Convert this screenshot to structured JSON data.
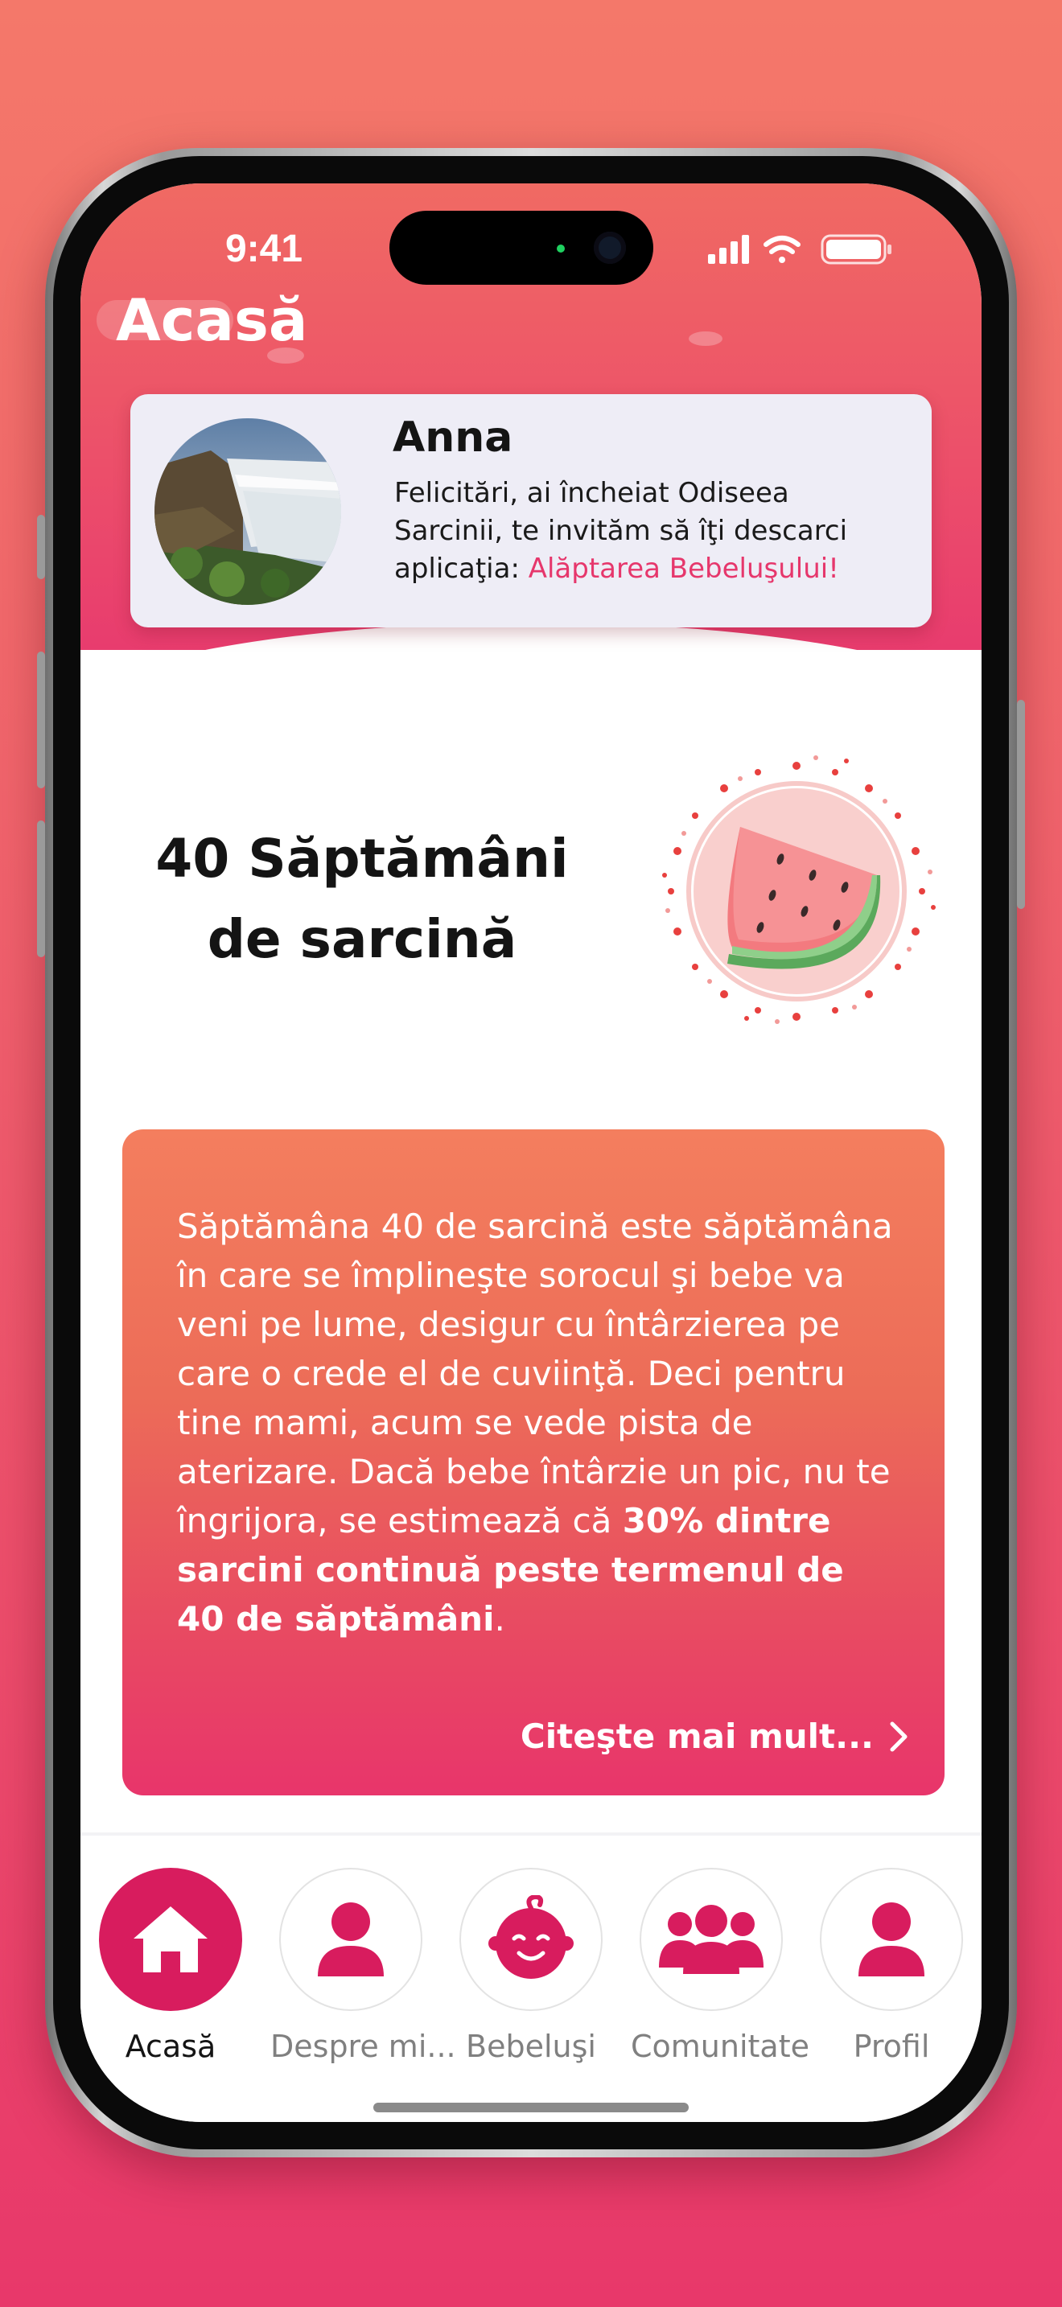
{
  "status_bar": {
    "time": "9:41"
  },
  "header": {
    "title": "Acasă"
  },
  "profile": {
    "name": "Anna",
    "message": "Felicitări, ai încheiat Odiseea Sarcinii, te invităm să îţi descarci aplicaţia: ",
    "link_text": "Alăptarea Bebeluşului!"
  },
  "week": {
    "title": "40 Săptămâni de sarcină",
    "illustration": "watermelon-slice"
  },
  "description": {
    "text_before": "Săptămâna 40 de sarcină este săptămâna în care se împlineşte sorocul şi bebe va veni pe lume, desigur cu întârzierea pe care o crede el de cuviinţă. Deci pentru tine mami, acum se vede pista de aterizare. Dacă bebe întârzie un pic, nu te îngrijora, se estimează că ",
    "text_bold": "30% dintre sarcini continuă peste termenul de 40 de săptămâni",
    "text_after": ".",
    "read_more": "Citeşte mai mult..."
  },
  "tabs": [
    {
      "label": "Acasă",
      "icon": "home-icon",
      "active": true
    },
    {
      "label": "Despre mi...",
      "icon": "person-icon",
      "active": false
    },
    {
      "label": "Bebeluşi",
      "icon": "baby-icon",
      "active": false
    },
    {
      "label": "Comunitate",
      "icon": "community-icon",
      "active": false
    },
    {
      "label": "Profil",
      "icon": "profile-icon",
      "active": false
    }
  ],
  "colors": {
    "accent": "#d81c5e",
    "link": "#e6376c",
    "header_gradient_top": "#f06a63",
    "header_gradient_bottom": "#e83c6e",
    "card_gradient_top": "#f47e5e",
    "card_gradient_bottom": "#e8356b"
  }
}
